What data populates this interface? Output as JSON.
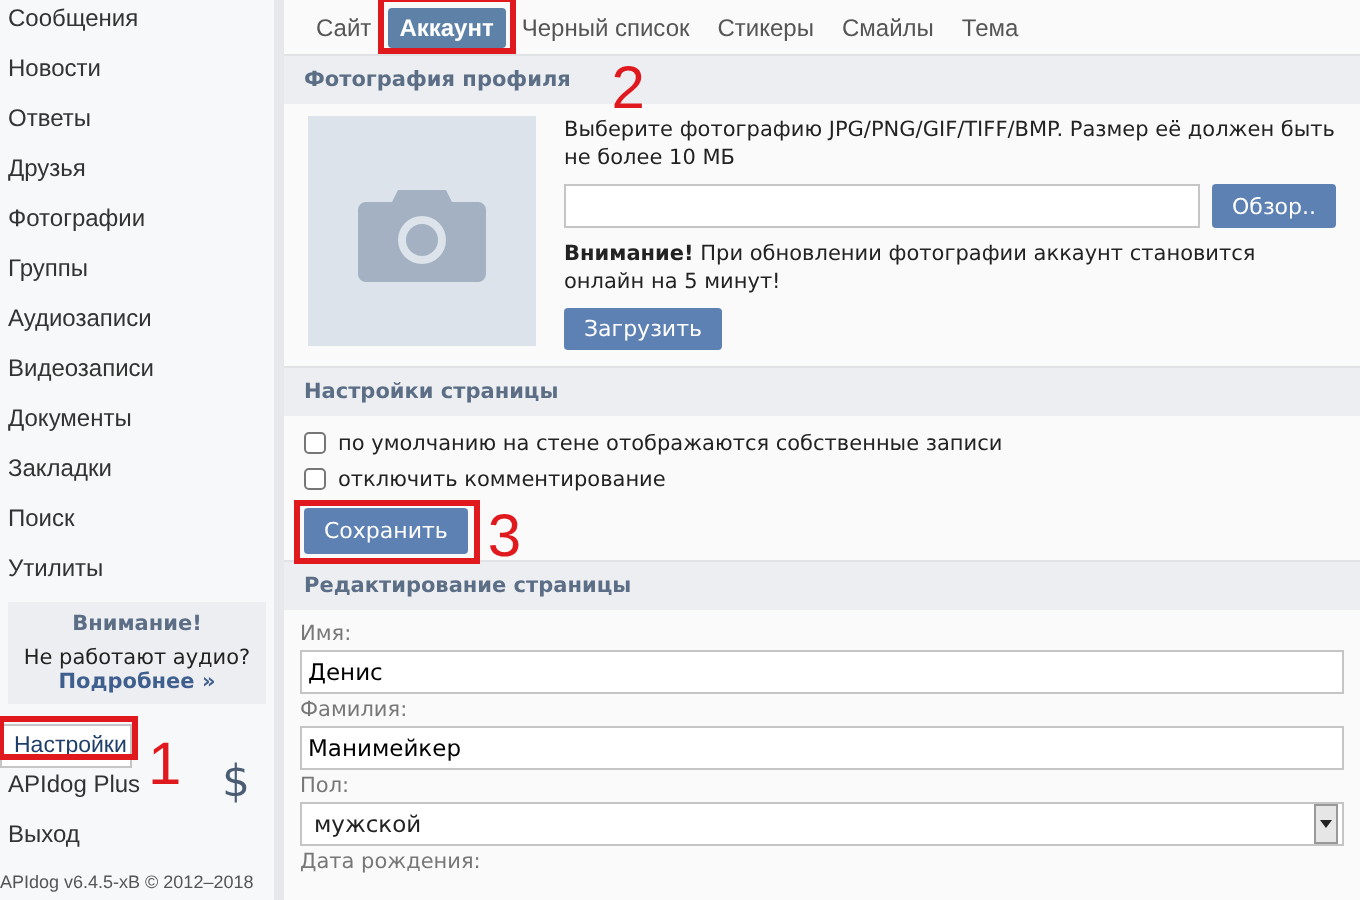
{
  "sidebar": {
    "items": [
      {
        "label": "Сообщения",
        "selected": false
      },
      {
        "label": "Новости",
        "selected": false
      },
      {
        "label": "Ответы",
        "selected": false
      },
      {
        "label": "Друзья",
        "selected": false
      },
      {
        "label": "Фотографии",
        "selected": false
      },
      {
        "label": "Группы",
        "selected": false
      },
      {
        "label": "Аудиозаписи",
        "selected": false
      },
      {
        "label": "Видеозаписи",
        "selected": false
      },
      {
        "label": "Документы",
        "selected": false
      },
      {
        "label": "Закладки",
        "selected": false
      },
      {
        "label": "Поиск",
        "selected": false
      },
      {
        "label": "Утилиты",
        "selected": false
      }
    ],
    "notice": {
      "title": "Внимание!",
      "text": "Не работают аудио?",
      "link": "Подробнее »"
    },
    "bottom_items": [
      {
        "label": "Настройки",
        "selected": true,
        "annotation": "1"
      },
      {
        "label": "APIdog Plus",
        "selected": false,
        "badge": "$"
      },
      {
        "label": "Выход",
        "selected": false
      }
    ],
    "version": "APIdog v6.4.5-xB © 2012–2018"
  },
  "tabs": [
    {
      "label": "Сайт",
      "selected": false
    },
    {
      "label": "Аккаунт",
      "selected": true,
      "annotation": "2"
    },
    {
      "label": "Черный список",
      "selected": false
    },
    {
      "label": "Стикеры",
      "selected": false
    },
    {
      "label": "Смайлы",
      "selected": false
    },
    {
      "label": "Тема",
      "selected": false
    }
  ],
  "photo_section": {
    "title": "Фотография профиля",
    "hint": "Выберите фотографию JPG/PNG/GIF/TIFF/BMP. Размер её должен быть не более 10 МБ",
    "browse_button": "Обзор..",
    "warning": "**Внимание!** При обновлении фотографии аккаунт становится онлайн на 5 минут!",
    "upload_button": "Загрузить"
  },
  "page_settings": {
    "title": "Настройки страницы",
    "options": [
      {
        "label": "по умолчанию на стене отображаются собственные записи",
        "checked": false
      },
      {
        "label": "отключить комментирование",
        "checked": false
      }
    ],
    "save_button": {
      "label": "Сохранить",
      "annotation": "3"
    }
  },
  "page_edit": {
    "title": "Редактирование страницы",
    "fields": [
      {
        "label": "Имя:",
        "value": "Денис",
        "kind": "text"
      },
      {
        "label": "Фамилия:",
        "value": "Манимейкер",
        "kind": "text"
      },
      {
        "label": "Пол:",
        "value": "мужской",
        "kind": "select"
      },
      {
        "label": "Дата рождения:",
        "kind": "label"
      }
    ]
  }
}
